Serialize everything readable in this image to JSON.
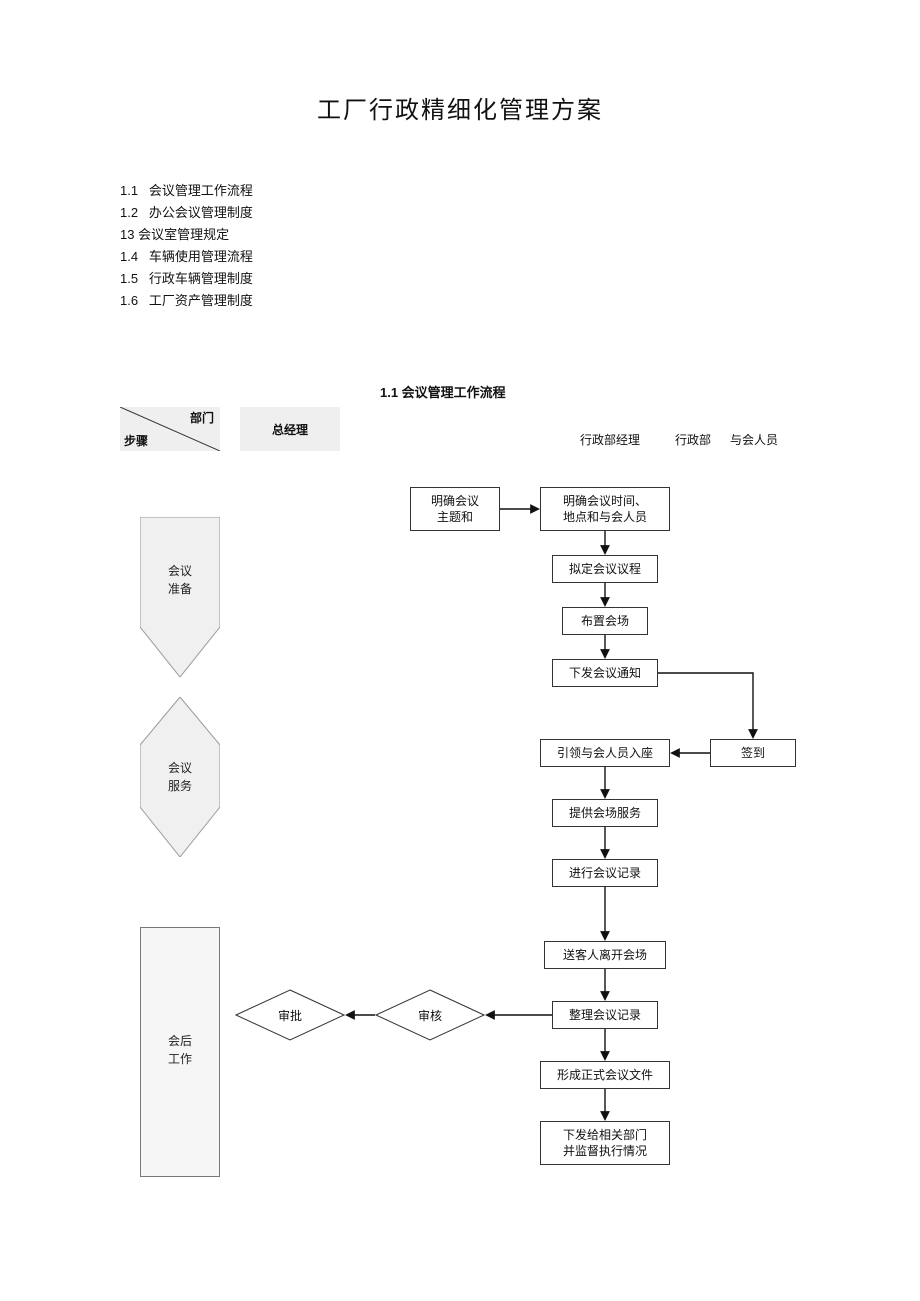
{
  "title": "工厂行政精细化管理方案",
  "toc": [
    "1.1   会议管理工作流程",
    "1.2   办公会议管理制度",
    "13 会议室管理规定",
    "1.4   车辆使用管理流程",
    "1.5   行政车辆管理制度",
    "1.6   工厂资产管理制度"
  ],
  "section_title": "1.1   会议管理工作流程",
  "header": {
    "dept": "部门",
    "step": "步骤",
    "gm": "总经理",
    "admin_mgr": "行政部经理",
    "admin": "行政部",
    "attendee": "与会人员"
  },
  "phases": {
    "prep": "会议\n准备",
    "service": "会议\n服务",
    "post": "会后\n工作"
  },
  "nodes": {
    "n1": "明确会议\n主题和",
    "n2": "明确会议时间、\n地点和与会人员",
    "n3": "拟定会议议程",
    "n4": "布置会场",
    "n5": "下发会议通知",
    "n6": "签到",
    "n7": "引领与会人员入座",
    "n8": "提供会场服务",
    "n9": "进行会议记录",
    "n10": "送客人离开会场",
    "d1": "审核",
    "d2": "审批",
    "n11": "整理会议记录",
    "n12": "形成正式会议文件",
    "n13": "下发给相关部门\n并监督执行情况"
  },
  "chart_data": {
    "type": "flowchart",
    "swimlanes": [
      "步骤/部门",
      "总经理",
      "行政部经理",
      "行政部",
      "与会人员"
    ],
    "phases": [
      {
        "id": "prep",
        "label": "会议准备",
        "style": "down-arrow"
      },
      {
        "id": "service",
        "label": "会议服务",
        "style": "down-arrow"
      },
      {
        "id": "post",
        "label": "会后工作",
        "style": "rect"
      }
    ],
    "nodes": [
      {
        "id": "n1",
        "label": "明确会议主题和",
        "lane": "行政部经理",
        "phase": "prep",
        "shape": "rect"
      },
      {
        "id": "n2",
        "label": "明确会议时间、地点和与会人员",
        "lane": "行政部",
        "phase": "prep",
        "shape": "rect"
      },
      {
        "id": "n3",
        "label": "拟定会议议程",
        "lane": "行政部",
        "phase": "prep",
        "shape": "rect"
      },
      {
        "id": "n4",
        "label": "布置会场",
        "lane": "行政部",
        "phase": "prep",
        "shape": "rect"
      },
      {
        "id": "n5",
        "label": "下发会议通知",
        "lane": "行政部",
        "phase": "prep",
        "shape": "rect"
      },
      {
        "id": "n6",
        "label": "签到",
        "lane": "与会人员",
        "phase": "service",
        "shape": "rect"
      },
      {
        "id": "n7",
        "label": "引领与会人员入座",
        "lane": "行政部",
        "phase": "service",
        "shape": "rect"
      },
      {
        "id": "n8",
        "label": "提供会场服务",
        "lane": "行政部",
        "phase": "service",
        "shape": "rect"
      },
      {
        "id": "n9",
        "label": "进行会议记录",
        "lane": "行政部",
        "phase": "service",
        "shape": "rect"
      },
      {
        "id": "n10",
        "label": "送客人离开会场",
        "lane": "行政部",
        "phase": "post",
        "shape": "rect"
      },
      {
        "id": "n11",
        "label": "整理会议记录",
        "lane": "行政部",
        "phase": "post",
        "shape": "rect"
      },
      {
        "id": "d1",
        "label": "审核",
        "lane": "行政部经理",
        "phase": "post",
        "shape": "diamond"
      },
      {
        "id": "d2",
        "label": "审批",
        "lane": "总经理",
        "phase": "post",
        "shape": "diamond"
      },
      {
        "id": "n12",
        "label": "形成正式会议文件",
        "lane": "行政部",
        "phase": "post",
        "shape": "rect"
      },
      {
        "id": "n13",
        "label": "下发给相关部门并监督执行情况",
        "lane": "行政部",
        "phase": "post",
        "shape": "rect"
      }
    ],
    "edges": [
      {
        "from": "n1",
        "to": "n2"
      },
      {
        "from": "n2",
        "to": "n3"
      },
      {
        "from": "n3",
        "to": "n4"
      },
      {
        "from": "n4",
        "to": "n5"
      },
      {
        "from": "n5",
        "to": "n6"
      },
      {
        "from": "n6",
        "to": "n7"
      },
      {
        "from": "n7",
        "to": "n8"
      },
      {
        "from": "n8",
        "to": "n9"
      },
      {
        "from": "n9",
        "to": "n10"
      },
      {
        "from": "n10",
        "to": "n11"
      },
      {
        "from": "n11",
        "to": "d1"
      },
      {
        "from": "d1",
        "to": "d2"
      },
      {
        "from": "n11",
        "to": "n12"
      },
      {
        "from": "n12",
        "to": "n13"
      }
    ]
  }
}
